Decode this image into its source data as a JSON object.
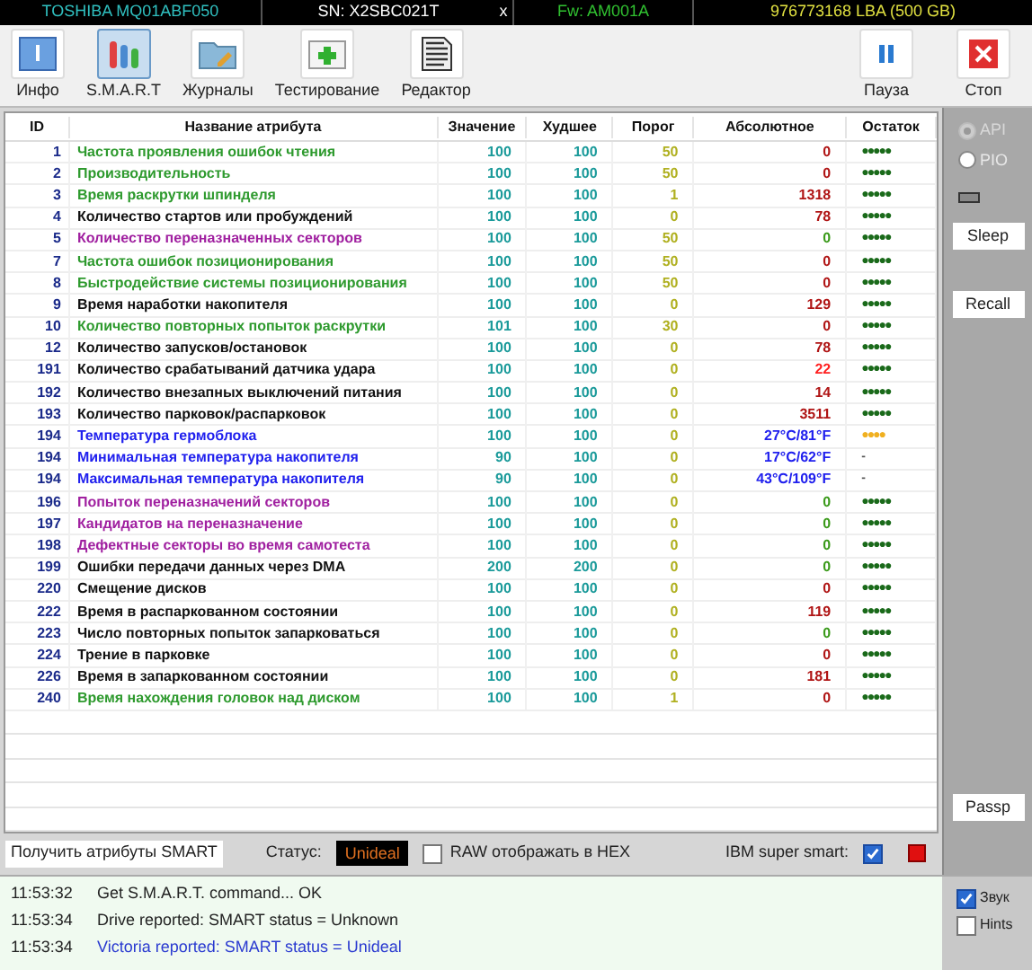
{
  "drive_bar": {
    "model": "TOSHIBA MQ01ABF050",
    "serial": "SN: X2SBC021T",
    "close": "x",
    "firmware": "Fw: AM001A",
    "capacity": "976773168 LBA (500 GB)"
  },
  "toolbar": [
    {
      "kind": "info",
      "label": "Инфо",
      "selected": false
    },
    {
      "kind": "smart",
      "label": "S.M.A.R.T",
      "selected": true
    },
    {
      "kind": "logs",
      "label": "Журналы",
      "selected": false
    },
    {
      "kind": "test",
      "label": "Тестирование",
      "selected": false
    },
    {
      "kind": "editor",
      "label": "Редактор",
      "selected": false
    }
  ],
  "toolbar_right": [
    {
      "kind": "pause",
      "label": "Пауза"
    },
    {
      "kind": "stop",
      "label": "Стоп"
    }
  ],
  "table": {
    "columns": [
      "ID",
      "Название атрибута",
      "Значение",
      "Худшее",
      "Порог",
      "Абсолютное",
      "Остаток"
    ],
    "rows": [
      {
        "id": "1",
        "name": "Частота проявления ошибок чтения",
        "color": "#2e9a2e",
        "value": "100",
        "worst": "100",
        "threshold": "50",
        "raw": {
          "text": "0",
          "color": "#b01515"
        },
        "health": {
          "text": "●●●●●",
          "color": "#1a6a1a"
        }
      },
      {
        "id": "2",
        "name": "Производительность",
        "color": "#2e9a2e",
        "value": "100",
        "worst": "100",
        "threshold": "50",
        "raw": {
          "text": "0",
          "color": "#b01515"
        },
        "health": {
          "text": "●●●●●",
          "color": "#1a6a1a"
        }
      },
      {
        "id": "3",
        "name": "Время раскрутки шпинделя",
        "color": "#2e9a2e",
        "value": "100",
        "worst": "100",
        "threshold": "1",
        "raw": {
          "text": "1318",
          "color": "#b01515"
        },
        "health": {
          "text": "●●●●●",
          "color": "#1a6a1a"
        }
      },
      {
        "id": "4",
        "name": "Количество стартов или пробуждений",
        "color": "#111111",
        "value": "100",
        "worst": "100",
        "threshold": "0",
        "raw": {
          "text": "78",
          "color": "#b01515"
        },
        "health": {
          "text": "●●●●●",
          "color": "#1a6a1a"
        }
      },
      {
        "id": "5",
        "name": "Количество переназначенных секторов",
        "color": "#a020a0",
        "value": "100",
        "worst": "100",
        "threshold": "50",
        "raw": {
          "text": "0",
          "color": "#3a9a1a"
        },
        "health": {
          "text": "●●●●●",
          "color": "#1a6a1a"
        }
      },
      {
        "id": "7",
        "name": "Частота ошибок позиционирования",
        "color": "#2e9a2e",
        "value": "100",
        "worst": "100",
        "threshold": "50",
        "raw": {
          "text": "0",
          "color": "#b01515"
        },
        "health": {
          "text": "●●●●●",
          "color": "#1a6a1a"
        }
      },
      {
        "id": "8",
        "name": "Быстродействие системы позиционирования",
        "color": "#2e9a2e",
        "value": "100",
        "worst": "100",
        "threshold": "50",
        "raw": {
          "text": "0",
          "color": "#b01515"
        },
        "health": {
          "text": "●●●●●",
          "color": "#1a6a1a"
        }
      },
      {
        "id": "9",
        "name": "Время наработки накопителя",
        "color": "#111111",
        "value": "100",
        "worst": "100",
        "threshold": "0",
        "raw": {
          "text": "129",
          "color": "#b01515"
        },
        "health": {
          "text": "●●●●●",
          "color": "#1a6a1a"
        }
      },
      {
        "id": "10",
        "name": "Количество повторных попыток раскрутки",
        "color": "#2e9a2e",
        "value": "101",
        "worst": "100",
        "threshold": "30",
        "raw": {
          "text": "0",
          "color": "#b01515"
        },
        "health": {
          "text": "●●●●●",
          "color": "#1a6a1a"
        }
      },
      {
        "id": "12",
        "name": "Количество запусков/остановок",
        "color": "#111111",
        "value": "100",
        "worst": "100",
        "threshold": "0",
        "raw": {
          "text": "78",
          "color": "#b01515"
        },
        "health": {
          "text": "●●●●●",
          "color": "#1a6a1a"
        }
      },
      {
        "id": "191",
        "name": "Количество срабатываний датчика удара",
        "color": "#111111",
        "value": "100",
        "worst": "100",
        "threshold": "0",
        "raw": {
          "text": "22",
          "color": "#ff2020"
        },
        "health": {
          "text": "●●●●●",
          "color": "#1a6a1a"
        }
      },
      {
        "id": "192",
        "name": "Количество внезапных выключений питания",
        "color": "#111111",
        "value": "100",
        "worst": "100",
        "threshold": "0",
        "raw": {
          "text": "14",
          "color": "#b01515"
        },
        "health": {
          "text": "●●●●●",
          "color": "#1a6a1a"
        }
      },
      {
        "id": "193",
        "name": "Количество парковок/распарковок",
        "color": "#111111",
        "value": "100",
        "worst": "100",
        "threshold": "0",
        "raw": {
          "text": "3511",
          "color": "#b01515"
        },
        "health": {
          "text": "●●●●●",
          "color": "#1a6a1a"
        }
      },
      {
        "id": "194",
        "name": "Температура гермоблока",
        "color": "#2020ee",
        "value": "100",
        "worst": "100",
        "threshold": "0",
        "raw": {
          "text": "27°C/81°F",
          "color": "#2020ee"
        },
        "health": {
          "text": "●●●●",
          "color": "#f0b020"
        }
      },
      {
        "id": "194",
        "name": "Минимальная температура накопителя",
        "color": "#2020ee",
        "value": "90",
        "worst": "100",
        "threshold": "0",
        "raw": {
          "text": "17°C/62°F",
          "color": "#2020ee"
        },
        "health": {
          "text": "-",
          "color": "#555555"
        }
      },
      {
        "id": "194",
        "name": "Максимальная температура накопителя",
        "color": "#2020ee",
        "value": "90",
        "worst": "100",
        "threshold": "0",
        "raw": {
          "text": "43°C/109°F",
          "color": "#2020ee"
        },
        "health": {
          "text": "-",
          "color": "#555555"
        }
      },
      {
        "id": "196",
        "name": "Попыток переназначений секторов",
        "color": "#a020a0",
        "value": "100",
        "worst": "100",
        "threshold": "0",
        "raw": {
          "text": "0",
          "color": "#3a9a1a"
        },
        "health": {
          "text": "●●●●●",
          "color": "#1a6a1a"
        }
      },
      {
        "id": "197",
        "name": "Кандидатов на переназначение",
        "color": "#a020a0",
        "value": "100",
        "worst": "100",
        "threshold": "0",
        "raw": {
          "text": "0",
          "color": "#3a9a1a"
        },
        "health": {
          "text": "●●●●●",
          "color": "#1a6a1a"
        }
      },
      {
        "id": "198",
        "name": "Дефектные секторы во время самотеста",
        "color": "#a020a0",
        "value": "100",
        "worst": "100",
        "threshold": "0",
        "raw": {
          "text": "0",
          "color": "#3a9a1a"
        },
        "health": {
          "text": "●●●●●",
          "color": "#1a6a1a"
        }
      },
      {
        "id": "199",
        "name": "Ошибки передачи данных через DMA",
        "color": "#111111",
        "value": "200",
        "worst": "200",
        "threshold": "0",
        "raw": {
          "text": "0",
          "color": "#3a9a1a"
        },
        "health": {
          "text": "●●●●●",
          "color": "#1a6a1a"
        }
      },
      {
        "id": "220",
        "name": "Смещение дисков",
        "color": "#111111",
        "value": "100",
        "worst": "100",
        "threshold": "0",
        "raw": {
          "text": "0",
          "color": "#b01515"
        },
        "health": {
          "text": "●●●●●",
          "color": "#1a6a1a"
        }
      },
      {
        "id": "222",
        "name": "Время в распаркованном состоянии",
        "color": "#111111",
        "value": "100",
        "worst": "100",
        "threshold": "0",
        "raw": {
          "text": "119",
          "color": "#b01515"
        },
        "health": {
          "text": "●●●●●",
          "color": "#1a6a1a"
        }
      },
      {
        "id": "223",
        "name": "Число повторных попыток запарковаться",
        "color": "#111111",
        "value": "100",
        "worst": "100",
        "threshold": "0",
        "raw": {
          "text": "0",
          "color": "#3a9a1a"
        },
        "health": {
          "text": "●●●●●",
          "color": "#1a6a1a"
        }
      },
      {
        "id": "224",
        "name": "Трение в парковке",
        "color": "#111111",
        "value": "100",
        "worst": "100",
        "threshold": "0",
        "raw": {
          "text": "0",
          "color": "#b01515"
        },
        "health": {
          "text": "●●●●●",
          "color": "#1a6a1a"
        }
      },
      {
        "id": "226",
        "name": "Время в запаркованном состоянии",
        "color": "#111111",
        "value": "100",
        "worst": "100",
        "threshold": "0",
        "raw": {
          "text": "181",
          "color": "#b01515"
        },
        "health": {
          "text": "●●●●●",
          "color": "#1a6a1a"
        }
      },
      {
        "id": "240",
        "name": "Время нахождения головок над диском",
        "color": "#2e9a2e",
        "value": "100",
        "worst": "100",
        "threshold": "1",
        "raw": {
          "text": "0",
          "color": "#b01515"
        },
        "health": {
          "text": "●●●●●",
          "color": "#1a6a1a"
        }
      }
    ]
  },
  "side_panel": {
    "modes": [
      {
        "label": "API",
        "selected": true,
        "disabled": true
      },
      {
        "label": "PIO",
        "selected": false,
        "disabled": false
      }
    ],
    "buttons": [
      "Sleep",
      "Recall"
    ],
    "passp": "Passp",
    "options": [
      {
        "label": "Звук",
        "checked": true
      },
      {
        "label": "Hints",
        "checked": false
      }
    ]
  },
  "status_bar": {
    "get_button": "Получить атрибуты SMART",
    "status_label": "Статус:",
    "status": "Unideal",
    "raw_hex": {
      "label": "RAW отображать в HEX",
      "checked": false
    },
    "ibm": {
      "label": "IBM super smart:",
      "checked": true
    }
  },
  "log": [
    {
      "time": "11:53:32",
      "message": "Get S.M.A.R.T. command... OK",
      "color": "#222222"
    },
    {
      "time": "11:53:34",
      "message": "Drive reported: SMART status = Unknown",
      "color": "#222222"
    },
    {
      "time": "11:53:34",
      "message": "Victoria reported: SMART status = Unideal",
      "color": "#2a3ad0"
    }
  ]
}
